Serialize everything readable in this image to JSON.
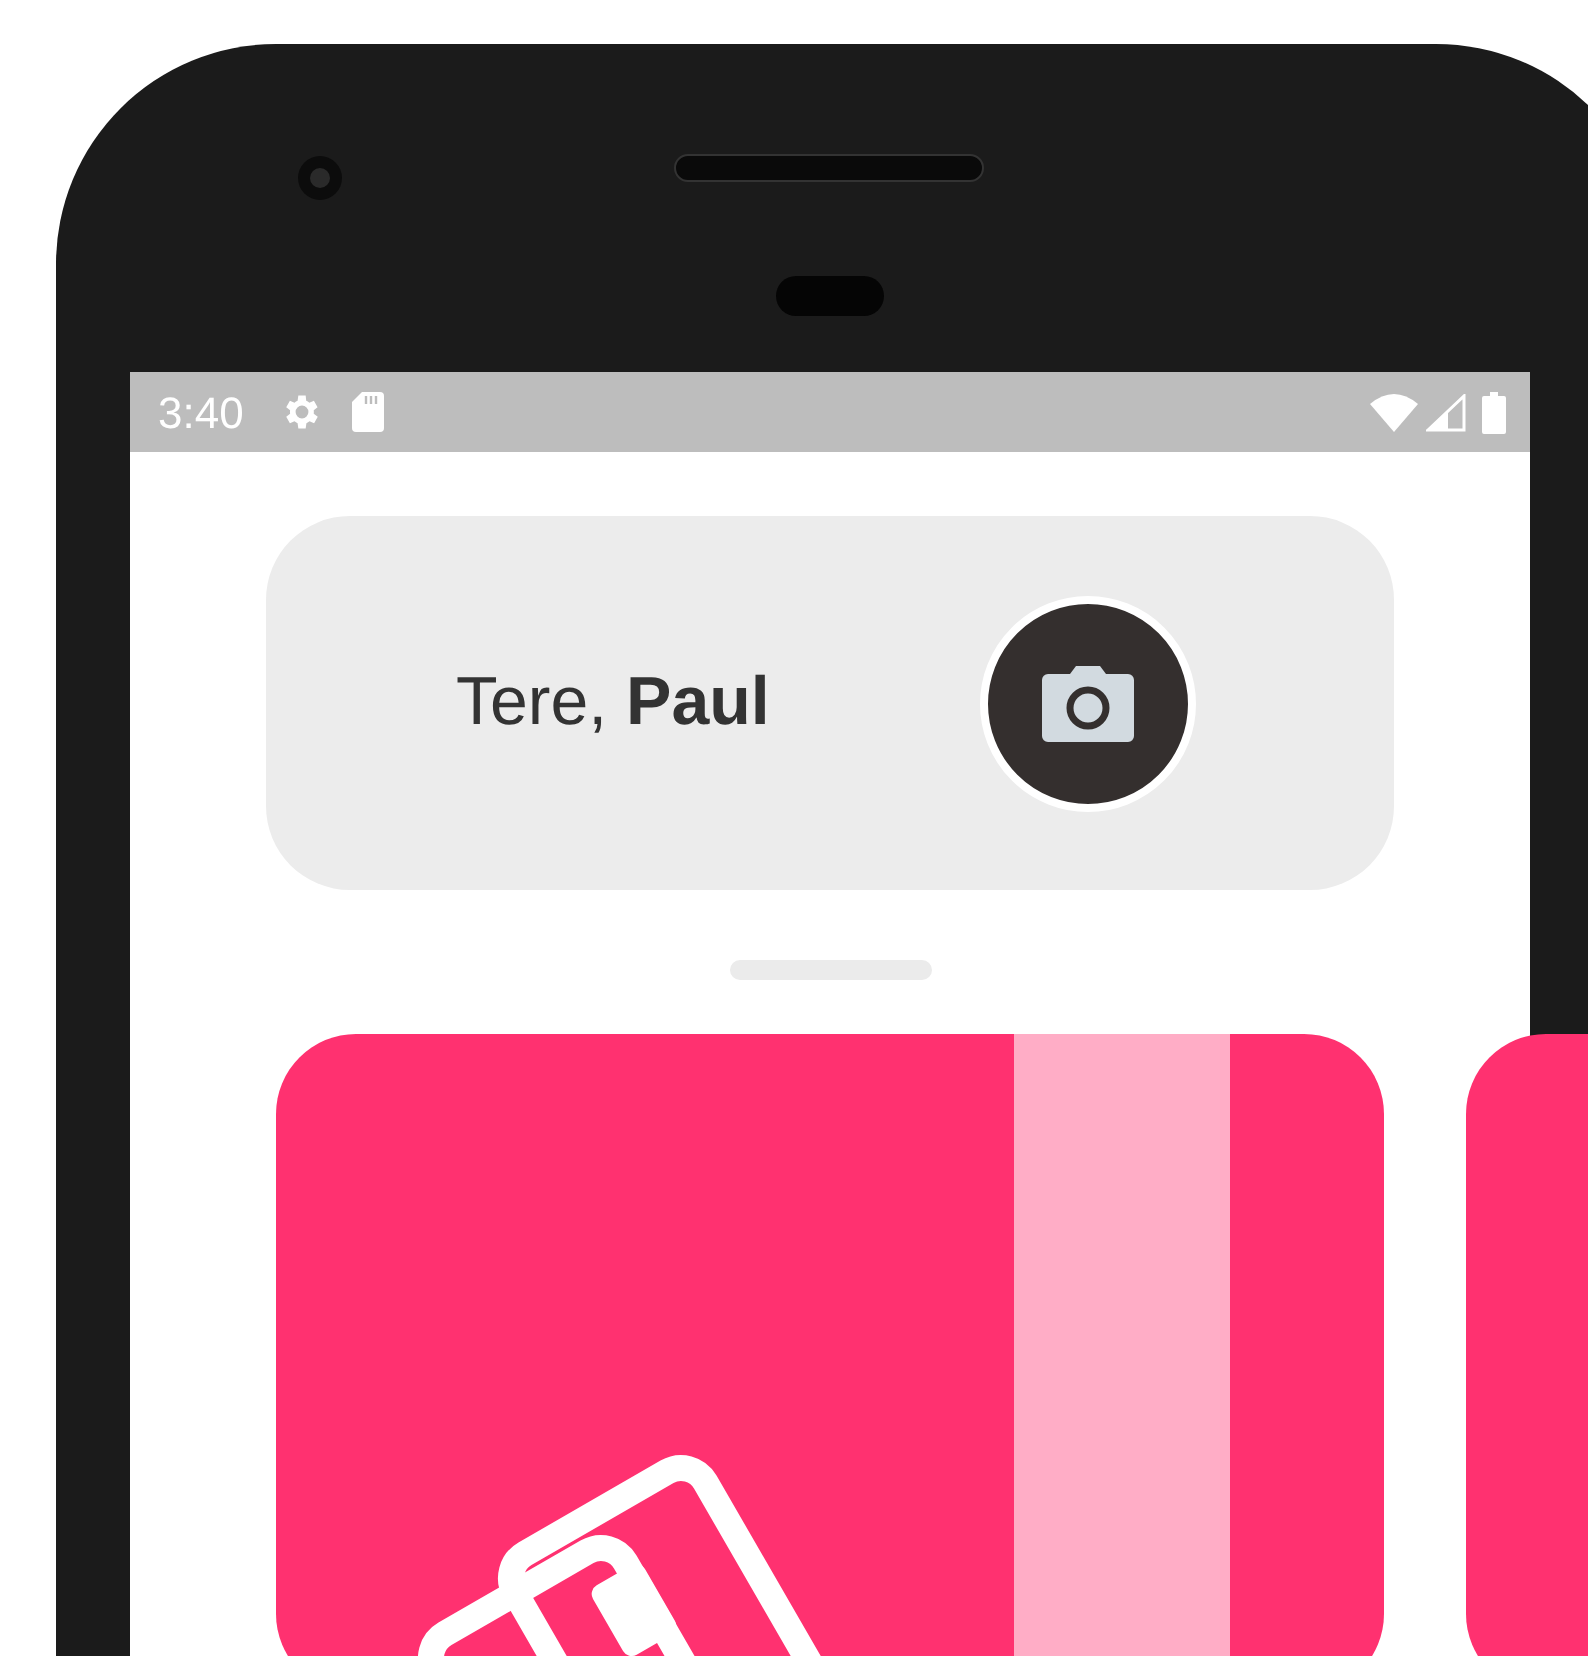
{
  "status_bar": {
    "time": "3:40"
  },
  "greeting": "Tere, **Paul**"
}
